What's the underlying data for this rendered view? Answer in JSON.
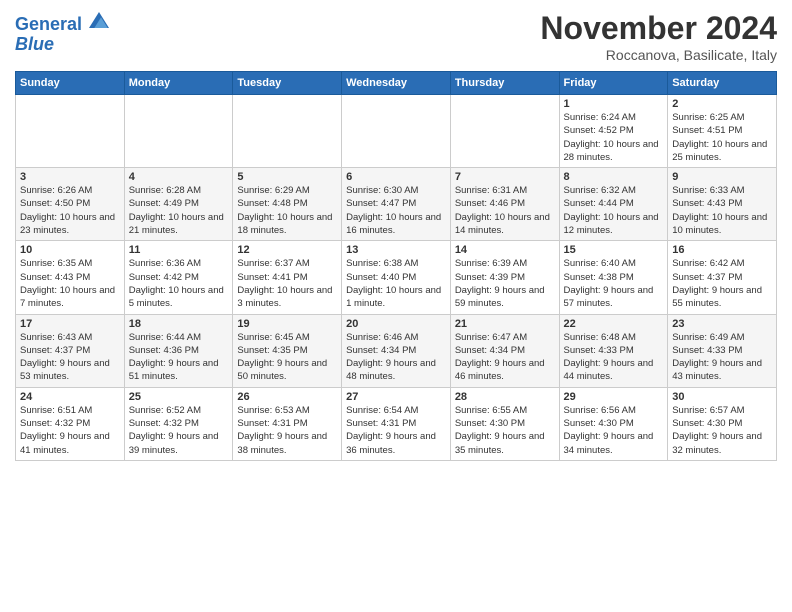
{
  "logo": {
    "line1": "General",
    "line2": "Blue"
  },
  "header": {
    "title": "November 2024",
    "location": "Roccanova, Basilicate, Italy"
  },
  "weekdays": [
    "Sunday",
    "Monday",
    "Tuesday",
    "Wednesday",
    "Thursday",
    "Friday",
    "Saturday"
  ],
  "weeks": [
    [
      {
        "day": "",
        "info": ""
      },
      {
        "day": "",
        "info": ""
      },
      {
        "day": "",
        "info": ""
      },
      {
        "day": "",
        "info": ""
      },
      {
        "day": "",
        "info": ""
      },
      {
        "day": "1",
        "info": "Sunrise: 6:24 AM\nSunset: 4:52 PM\nDaylight: 10 hours and 28 minutes."
      },
      {
        "day": "2",
        "info": "Sunrise: 6:25 AM\nSunset: 4:51 PM\nDaylight: 10 hours and 25 minutes."
      }
    ],
    [
      {
        "day": "3",
        "info": "Sunrise: 6:26 AM\nSunset: 4:50 PM\nDaylight: 10 hours and 23 minutes."
      },
      {
        "day": "4",
        "info": "Sunrise: 6:28 AM\nSunset: 4:49 PM\nDaylight: 10 hours and 21 minutes."
      },
      {
        "day": "5",
        "info": "Sunrise: 6:29 AM\nSunset: 4:48 PM\nDaylight: 10 hours and 18 minutes."
      },
      {
        "day": "6",
        "info": "Sunrise: 6:30 AM\nSunset: 4:47 PM\nDaylight: 10 hours and 16 minutes."
      },
      {
        "day": "7",
        "info": "Sunrise: 6:31 AM\nSunset: 4:46 PM\nDaylight: 10 hours and 14 minutes."
      },
      {
        "day": "8",
        "info": "Sunrise: 6:32 AM\nSunset: 4:44 PM\nDaylight: 10 hours and 12 minutes."
      },
      {
        "day": "9",
        "info": "Sunrise: 6:33 AM\nSunset: 4:43 PM\nDaylight: 10 hours and 10 minutes."
      }
    ],
    [
      {
        "day": "10",
        "info": "Sunrise: 6:35 AM\nSunset: 4:43 PM\nDaylight: 10 hours and 7 minutes."
      },
      {
        "day": "11",
        "info": "Sunrise: 6:36 AM\nSunset: 4:42 PM\nDaylight: 10 hours and 5 minutes."
      },
      {
        "day": "12",
        "info": "Sunrise: 6:37 AM\nSunset: 4:41 PM\nDaylight: 10 hours and 3 minutes."
      },
      {
        "day": "13",
        "info": "Sunrise: 6:38 AM\nSunset: 4:40 PM\nDaylight: 10 hours and 1 minute."
      },
      {
        "day": "14",
        "info": "Sunrise: 6:39 AM\nSunset: 4:39 PM\nDaylight: 9 hours and 59 minutes."
      },
      {
        "day": "15",
        "info": "Sunrise: 6:40 AM\nSunset: 4:38 PM\nDaylight: 9 hours and 57 minutes."
      },
      {
        "day": "16",
        "info": "Sunrise: 6:42 AM\nSunset: 4:37 PM\nDaylight: 9 hours and 55 minutes."
      }
    ],
    [
      {
        "day": "17",
        "info": "Sunrise: 6:43 AM\nSunset: 4:37 PM\nDaylight: 9 hours and 53 minutes."
      },
      {
        "day": "18",
        "info": "Sunrise: 6:44 AM\nSunset: 4:36 PM\nDaylight: 9 hours and 51 minutes."
      },
      {
        "day": "19",
        "info": "Sunrise: 6:45 AM\nSunset: 4:35 PM\nDaylight: 9 hours and 50 minutes."
      },
      {
        "day": "20",
        "info": "Sunrise: 6:46 AM\nSunset: 4:34 PM\nDaylight: 9 hours and 48 minutes."
      },
      {
        "day": "21",
        "info": "Sunrise: 6:47 AM\nSunset: 4:34 PM\nDaylight: 9 hours and 46 minutes."
      },
      {
        "day": "22",
        "info": "Sunrise: 6:48 AM\nSunset: 4:33 PM\nDaylight: 9 hours and 44 minutes."
      },
      {
        "day": "23",
        "info": "Sunrise: 6:49 AM\nSunset: 4:33 PM\nDaylight: 9 hours and 43 minutes."
      }
    ],
    [
      {
        "day": "24",
        "info": "Sunrise: 6:51 AM\nSunset: 4:32 PM\nDaylight: 9 hours and 41 minutes."
      },
      {
        "day": "25",
        "info": "Sunrise: 6:52 AM\nSunset: 4:32 PM\nDaylight: 9 hours and 39 minutes."
      },
      {
        "day": "26",
        "info": "Sunrise: 6:53 AM\nSunset: 4:31 PM\nDaylight: 9 hours and 38 minutes."
      },
      {
        "day": "27",
        "info": "Sunrise: 6:54 AM\nSunset: 4:31 PM\nDaylight: 9 hours and 36 minutes."
      },
      {
        "day": "28",
        "info": "Sunrise: 6:55 AM\nSunset: 4:30 PM\nDaylight: 9 hours and 35 minutes."
      },
      {
        "day": "29",
        "info": "Sunrise: 6:56 AM\nSunset: 4:30 PM\nDaylight: 9 hours and 34 minutes."
      },
      {
        "day": "30",
        "info": "Sunrise: 6:57 AM\nSunset: 4:30 PM\nDaylight: 9 hours and 32 minutes."
      }
    ]
  ]
}
